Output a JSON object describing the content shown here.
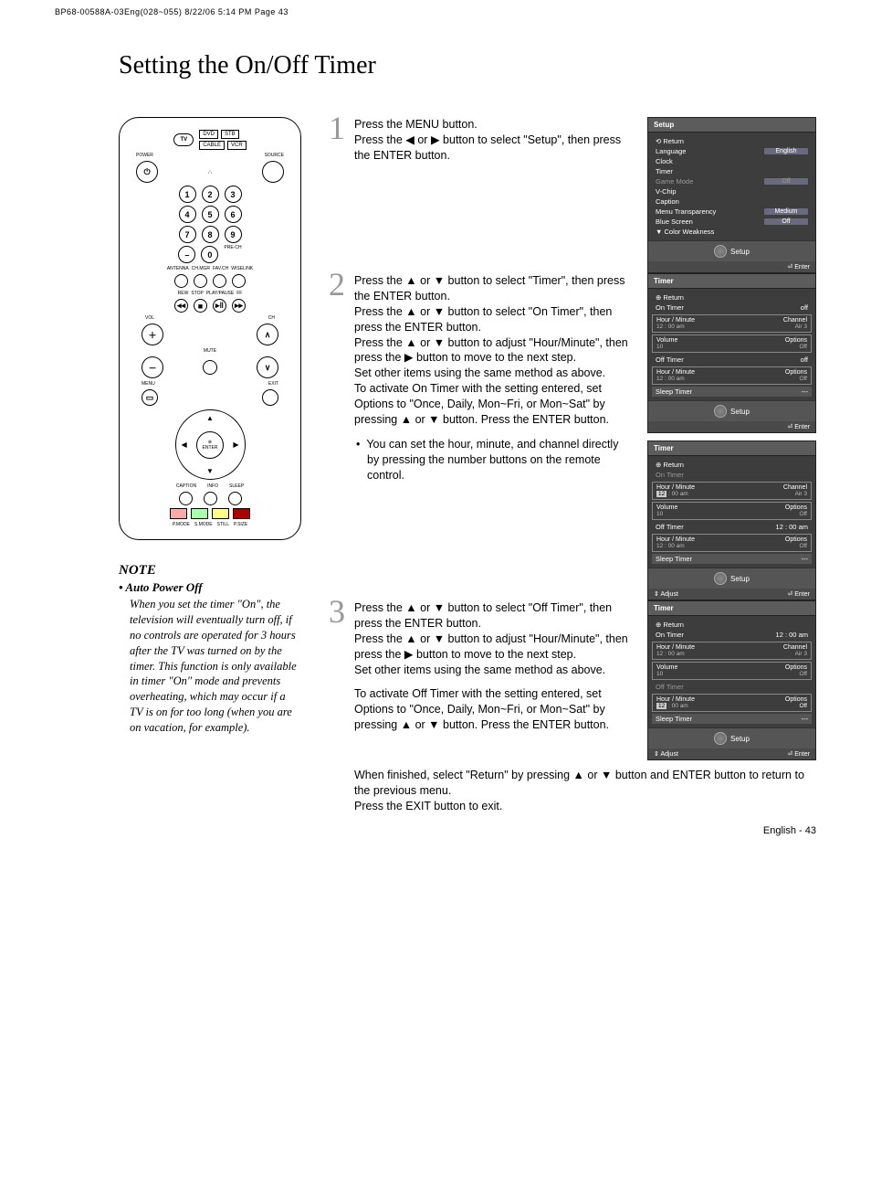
{
  "header": "BP68-00588A-03Eng(028~055)  8/22/06  5:14 PM  Page 43",
  "title": "Setting the On/Off Timer",
  "remote": {
    "src": [
      "DVD",
      "STB",
      "CABLE",
      "VCR"
    ],
    "tv": "TV",
    "power": "POWER",
    "source": "SOURCE",
    "nums": [
      "1",
      "2",
      "3",
      "4",
      "5",
      "6",
      "7",
      "8",
      "9",
      "0"
    ],
    "labels": [
      "ANTENNA",
      "CH.MGR",
      "FAV.CH",
      "WISELINK",
      "REW",
      "STOP",
      "PLAY/PAUSE",
      "FF",
      "VOL",
      "CH",
      "MUTE",
      "MENU",
      "EXIT",
      "ENTER",
      "CAPTION",
      "INFO",
      "SLEEP",
      "P.MODE",
      "S.MODE",
      "STILL",
      "P.SIZE"
    ],
    "pre": "PRE-CH"
  },
  "note": {
    "head": "NOTE",
    "sub": "Auto Power Off",
    "body": "When you set the timer \"On\", the television will eventually turn off, if no controls are operated for 3 hours after the TV was turned on by the timer. This function is only available in timer \"On\" mode and prevents overheating, which may occur if a TV is on for too long (when you are on vacation, for example)."
  },
  "steps": {
    "s1": "Press the MENU button.\nPress the ◀ or ▶ button to select \"Setup\", then press  the ENTER button.",
    "s2a": "Press the ▲ or ▼ button to select \"Timer\", then press the ENTER button.\nPress the ▲ or ▼ button to select \"On Timer\", then press the ENTER button.\nPress the ▲ or ▼ button to adjust \"Hour/Minute\", then press the ▶ button to move to the next step.\nSet other items using the same method as above.\nTo activate On Timer with the setting entered, set Options to \"Once, Daily, Mon~Fri, or Mon~Sat\" by pressing ▲ or ▼ button. Press the ENTER button.",
    "s2b": "You can set the hour, minute, and channel directly by pressing the number buttons on the remote control.",
    "s3a": "Press the ▲ or ▼ button to select \"Off Timer\", then press the ENTER button.\nPress the ▲ or ▼ button to adjust \"Hour/Minute\", then press the ▶ button to move to the next step.\nSet other items using the same method as above.",
    "s3b": "To activate Off Timer with the setting entered, set Options to \"Once, Daily, Mon~Fri, or Mon~Sat\" by pressing ▲ or ▼ button. Press the ENTER button."
  },
  "finish": "When finished, select \"Return\" by pressing ▲ or ▼ button and ENTER button to return to the previous menu.\nPress the EXIT button to exit.",
  "pagenum": "English - 43",
  "osd1": {
    "title": "Setup",
    "ret": "Return",
    "rows": [
      [
        "Language",
        "English"
      ],
      [
        "Clock",
        ""
      ],
      [
        "Timer",
        ""
      ],
      [
        "Game Mode",
        "Off"
      ],
      [
        "V-Chip",
        ""
      ],
      [
        "Caption",
        ""
      ],
      [
        "Menu Transparency",
        "Medium"
      ],
      [
        "Blue Screen",
        "Off"
      ],
      [
        "▼ Color Weakness",
        ""
      ]
    ],
    "foot": "Setup",
    "hint": "Enter"
  },
  "osd2": {
    "title": "Timer",
    "ret": "Return",
    "ontimer": [
      "On Timer",
      "off"
    ],
    "b1h": [
      "Hour / Minute",
      "Channel"
    ],
    "b1v": [
      "12 : 00  am",
      "Air      3"
    ],
    "b2h": [
      "Volume",
      "Options"
    ],
    "b2v": [
      "10",
      "Off"
    ],
    "offtimer": [
      "Off Timer",
      "off"
    ],
    "b3h": [
      "Hour / Minute",
      "Options"
    ],
    "b3v": [
      "12 : 00  am",
      "Off"
    ],
    "sleep": [
      "Sleep Timer",
      "---"
    ],
    "foot": "Setup",
    "hint": "Enter"
  },
  "osd3": {
    "title": "Timer",
    "ret": "Return",
    "ontimer": [
      "On Timer",
      ""
    ],
    "b1h": [
      "Hour / Minute",
      "Channel"
    ],
    "b1v": [
      "12 : 00  am",
      "Air      3"
    ],
    "b2h": [
      "Volume",
      "Options"
    ],
    "b2v": [
      "10",
      "Off"
    ],
    "offtimer": [
      "Off Timer",
      "12 : 00 am"
    ],
    "b3h": [
      "Hour / Minute",
      "Options"
    ],
    "b3v": [
      "12 : 00  am",
      "Off"
    ],
    "sleep": [
      "Sleep Timer",
      "---"
    ],
    "foot": "Setup",
    "hintL": "Adjust",
    "hintR": "Enter"
  },
  "osd4": {
    "title": "Timer",
    "ret": "Return",
    "ontimer": [
      "On Timer",
      "12 : 00 am"
    ],
    "b1h": [
      "Hour / Minute",
      "Channel"
    ],
    "b1v": [
      "12 : 00  am",
      "Air      3"
    ],
    "b2h": [
      "Volume",
      "Options"
    ],
    "b2v": [
      "10",
      "Off"
    ],
    "offtimer": [
      "Off Timer",
      ""
    ],
    "b3h": [
      "Hour / Minute",
      "Options"
    ],
    "b3v": [
      "12 : 00  am",
      "Off"
    ],
    "sleep": [
      "Sleep Timer",
      "---"
    ],
    "foot": "Setup",
    "hintL": "Adjust",
    "hintR": "Enter"
  }
}
